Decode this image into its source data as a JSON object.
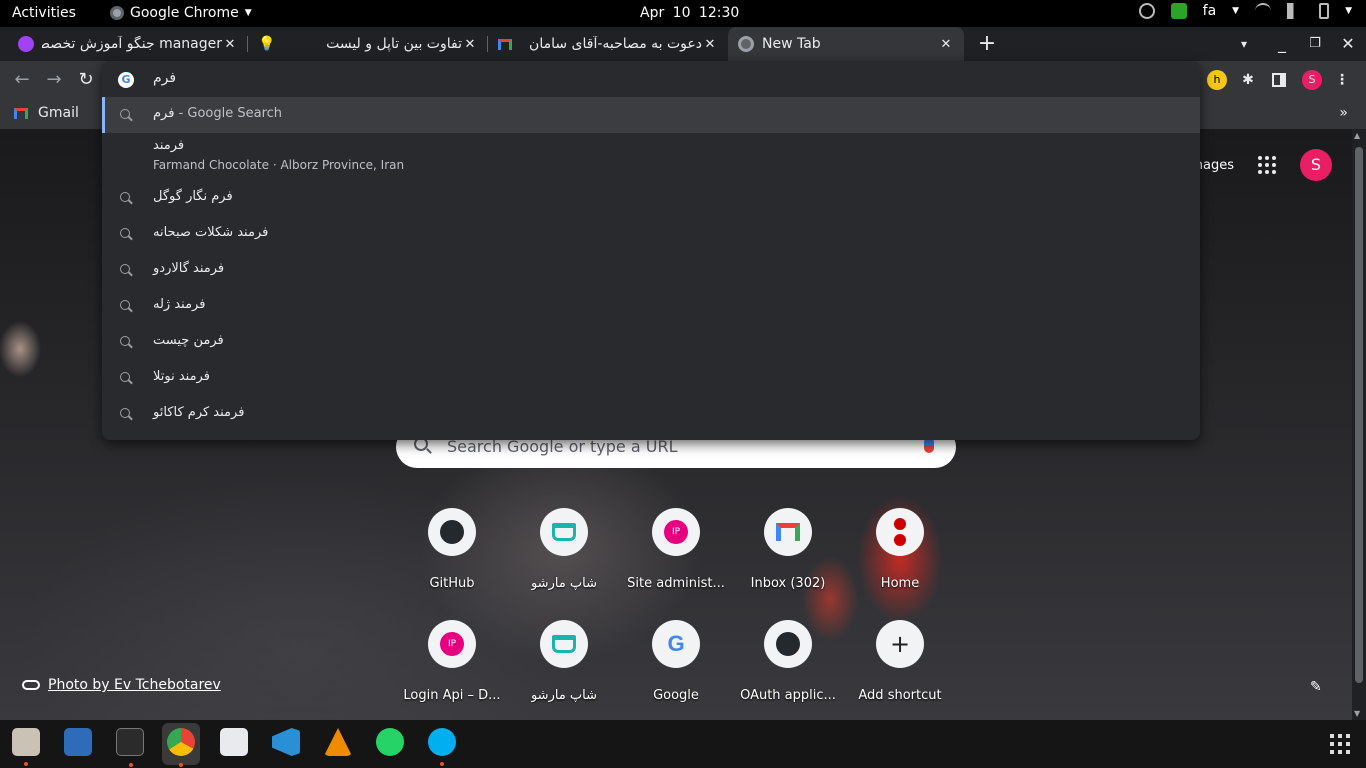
{
  "topbar": {
    "activities": "Activities",
    "app_name": "Google Chrome",
    "clock": "Apr 10  12:30",
    "lang": "fa"
  },
  "tabs": [
    {
      "title": "manager جنگو آموزش تخصصی",
      "fav_color": "#a142f4"
    },
    {
      "title": "تفاوت بین تاپل و لیست",
      "fav_color": "#f9ab00"
    },
    {
      "title": "دعوت به مصاحبه-آقای سامان",
      "fav_color": "#ea4335"
    },
    {
      "title": "New Tab",
      "fav_color": "#9aa0a6"
    }
  ],
  "omnibox": {
    "value": "فرم",
    "suggestions": [
      {
        "query": "فرم",
        "suffix": " - Google Search"
      },
      {
        "entity_title": "فرمند",
        "entity_sub": "Farmand Chocolate · Alborz Province, Iran"
      },
      {
        "query": "فرم نگار گوگل"
      },
      {
        "query": "فرمند شکلات صبحانه"
      },
      {
        "query": "فرمند گالاردو"
      },
      {
        "query": "فرمند ژله"
      },
      {
        "query": "فرمن چیست"
      },
      {
        "query": "فرمند نوتلا"
      },
      {
        "query": "فرمند کرم کاکائو"
      }
    ]
  },
  "bookmarks": {
    "gmail": "Gmail",
    "more": "»"
  },
  "profile_initial": "S",
  "ntp": {
    "images_link": "nages",
    "avatar": "S",
    "search_placeholder": "Search Google or type a URL",
    "shortcuts": [
      {
        "label": "GitHub",
        "icon": "github-icon"
      },
      {
        "label": "شاپ مارشو",
        "icon": "shop-icon"
      },
      {
        "label": "Site administ...",
        "icon": "ip-icon"
      },
      {
        "label": "Inbox (302)",
        "icon": "gmail-icon"
      },
      {
        "label": "Home",
        "icon": "home-icon"
      },
      {
        "label": "Login Api – D...",
        "icon": "ip-icon"
      },
      {
        "label": "شاپ مارشو",
        "icon": "shop-icon"
      },
      {
        "label": "Google",
        "icon": "google-icon"
      },
      {
        "label": "OAuth applic...",
        "icon": "github-icon"
      },
      {
        "label": "Add shortcut",
        "icon": "plus-icon"
      }
    ],
    "photo_credit": "Photo by Ev Tchebotarev"
  }
}
